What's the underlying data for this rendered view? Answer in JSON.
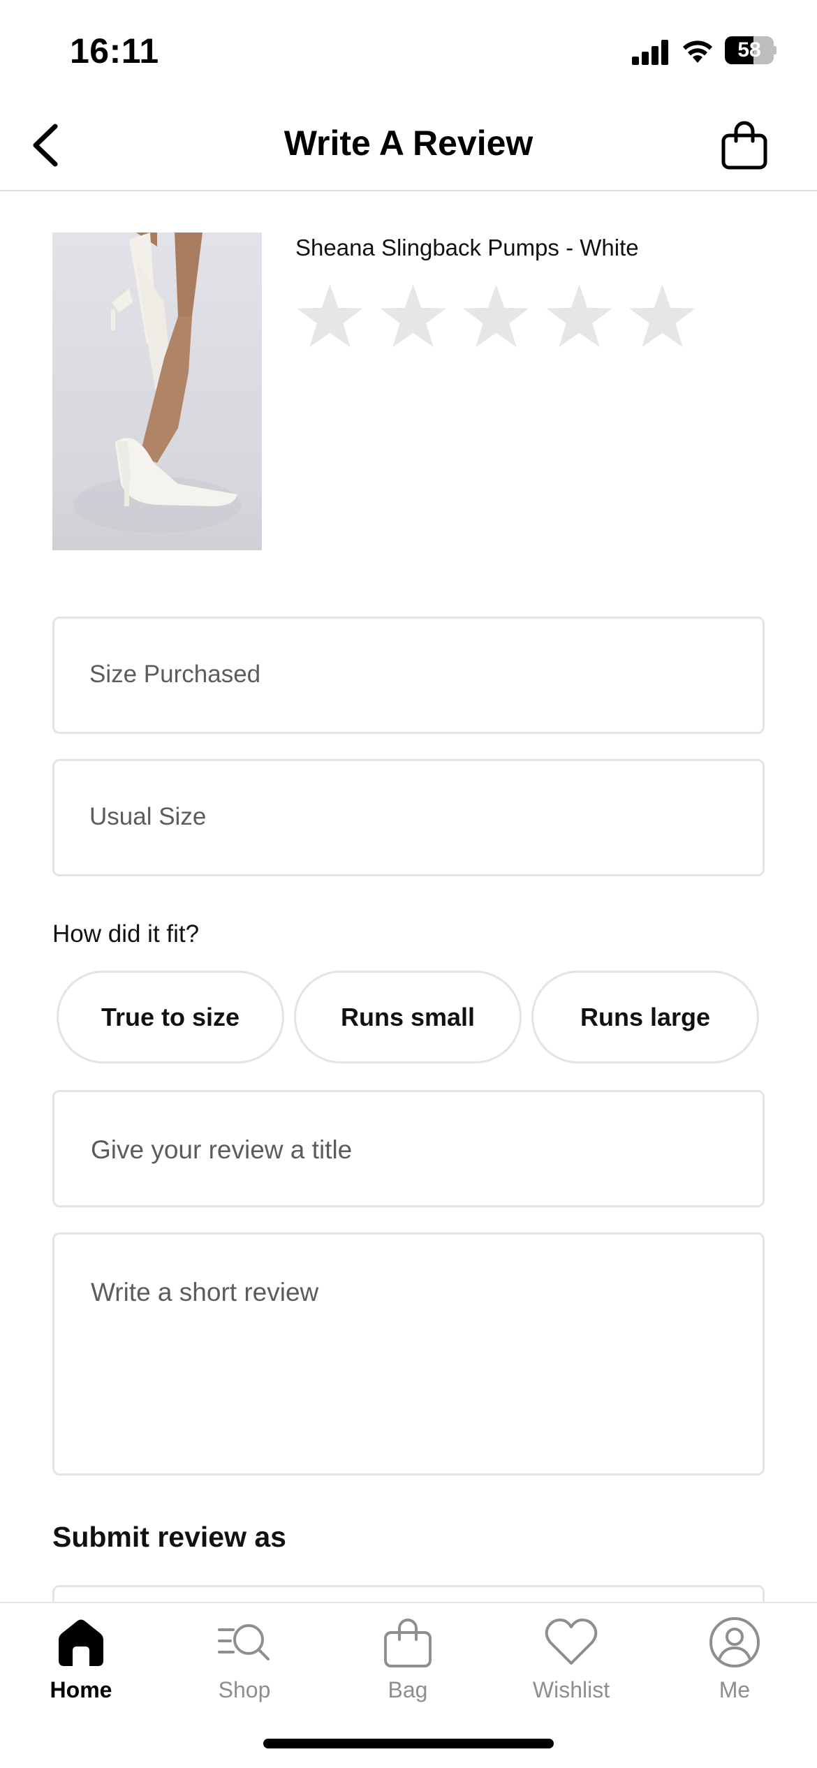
{
  "status_bar": {
    "time": "16:11",
    "battery_level": "58",
    "battery_fraction": 0.58
  },
  "header": {
    "title": "Write A Review",
    "back_icon": "chevron-left-icon",
    "bag_icon": "shopping-bag-icon"
  },
  "product": {
    "name": "Sheana Slingback Pumps - White",
    "image_icon": "product-photo",
    "rating": {
      "value": 0,
      "max": 5,
      "empty_color": "#e6e6e6"
    }
  },
  "form": {
    "size_purchased_label": "Size Purchased",
    "usual_size_label": "Usual Size",
    "fit_question": "How did it fit?",
    "fit_options": [
      "True to size",
      "Runs small",
      "Runs large"
    ],
    "title_placeholder": "Give your review a title",
    "review_placeholder": "Write a short review",
    "submit_as_heading": "Submit review as"
  },
  "tab_bar": {
    "tabs": [
      {
        "label": "Home",
        "icon": "home-icon",
        "active": true
      },
      {
        "label": "Shop",
        "icon": "shop-search-icon",
        "active": false
      },
      {
        "label": "Bag",
        "icon": "bag-icon",
        "active": false
      },
      {
        "label": "Wishlist",
        "icon": "heart-icon",
        "active": false
      },
      {
        "label": "Me",
        "icon": "profile-icon",
        "active": false
      }
    ]
  },
  "colors": {
    "border": "#e4e4e4",
    "inactive_tab": "#8e8e8e",
    "placeholder": "#5c5c5c"
  }
}
